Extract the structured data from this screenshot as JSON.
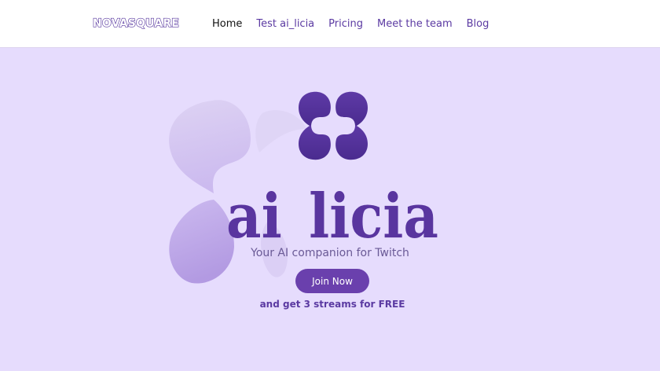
{
  "brand": {
    "logo_text": "NOVASQUARE"
  },
  "nav": {
    "items": [
      {
        "label": "Home",
        "active": true
      },
      {
        "label": "Test ai_licia",
        "active": false
      },
      {
        "label": "Pricing",
        "active": false
      },
      {
        "label": "Meet the team",
        "active": false
      },
      {
        "label": "Blog",
        "active": false
      }
    ]
  },
  "hero": {
    "product_name": "ai_licia",
    "tagline": "Your AI companion for Twitch",
    "cta_label": "Join Now",
    "cta_note": "and get 3 streams for FREE"
  },
  "icons": {
    "logo_mark": "four-petal-flower-icon",
    "background_decoration": "faded-petal-decoration"
  },
  "colors": {
    "page_background": "#e6dcfd",
    "brand_purple": "#5b3aa2",
    "button": "#6a40ad"
  }
}
